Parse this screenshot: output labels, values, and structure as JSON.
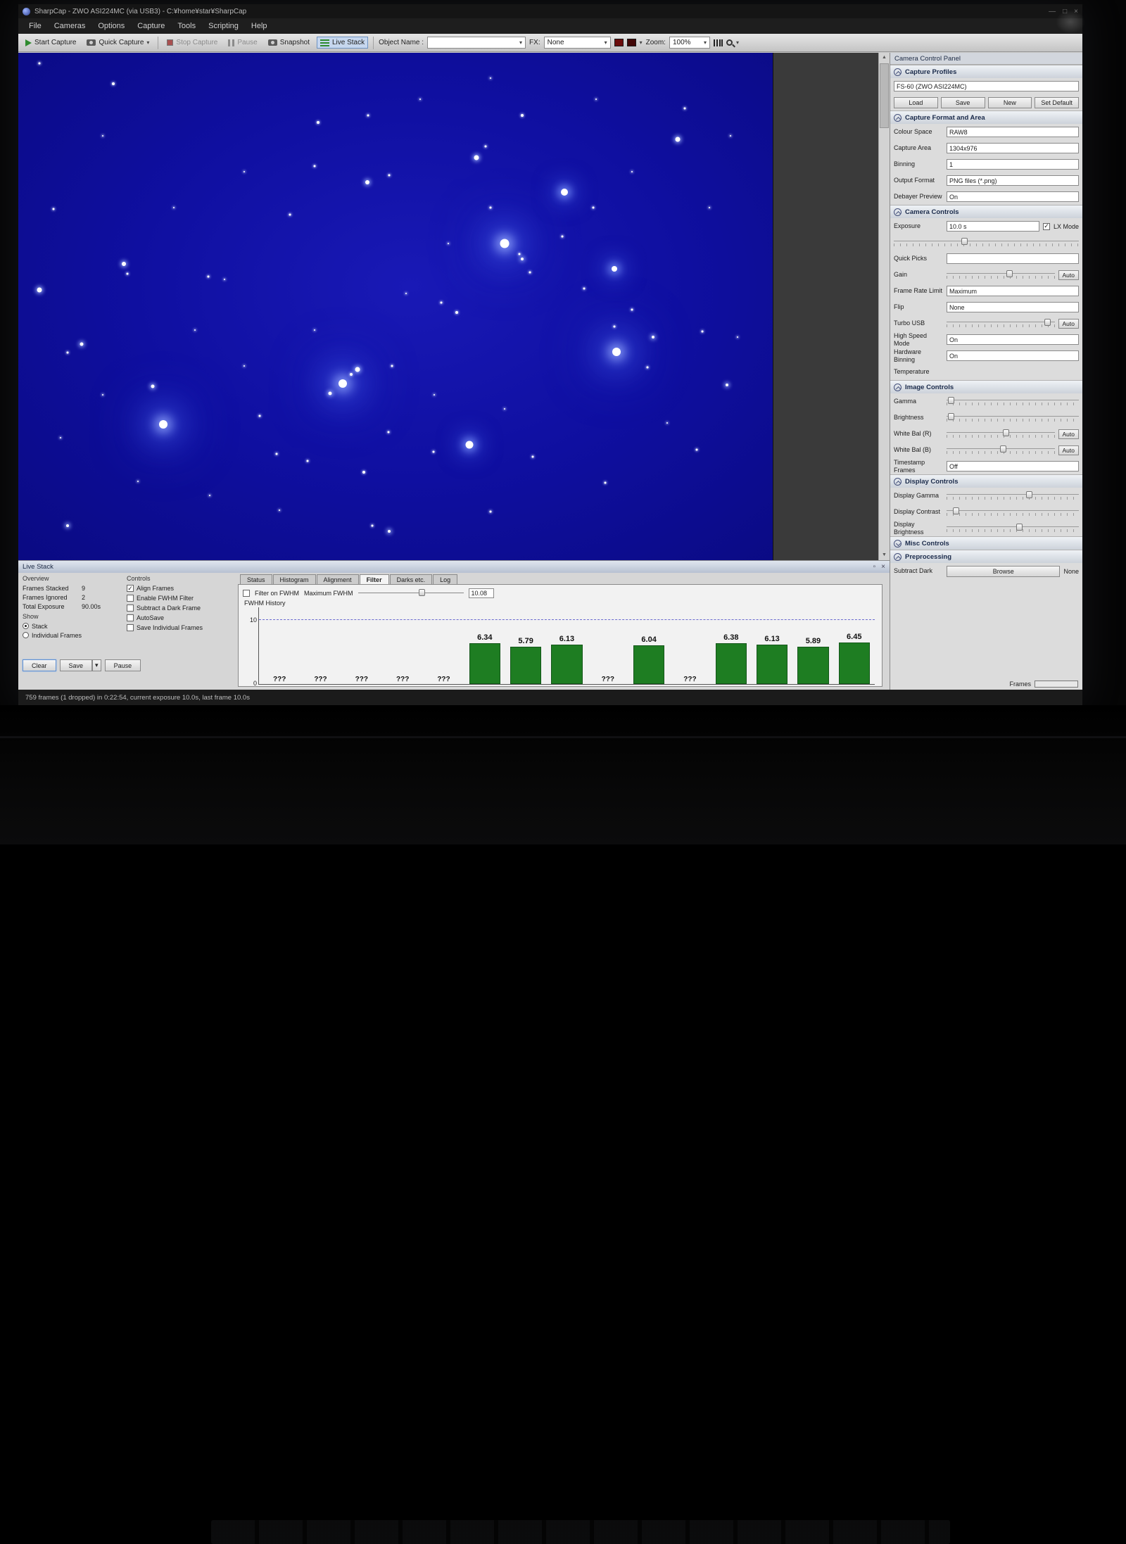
{
  "window": {
    "title": "SharpCap - ZWO ASI224MC (via USB3) - C:¥home¥star¥SharpCap"
  },
  "menu": {
    "items": [
      "File",
      "Cameras",
      "Options",
      "Capture",
      "Tools",
      "Scripting",
      "Help"
    ]
  },
  "toolbar": {
    "start_capture": "Start Capture",
    "quick_capture": "Quick Capture",
    "stop_capture": "Stop Capture",
    "pause": "Pause",
    "snapshot": "Snapshot",
    "live_stack": "Live Stack",
    "object_name_label": "Object Name :",
    "object_name_value": "",
    "fx_label": "FX:",
    "fx_value": "None",
    "zoom_label": "Zoom:",
    "zoom_value": "100%",
    "swatch1": "#6b0c0c",
    "swatch2": "#420808"
  },
  "camera_panel": {
    "title": "Camera Control Panel",
    "sections": [
      {
        "title": "Capture Profiles",
        "collapsed": false,
        "rows": [
          {
            "type": "wideinput",
            "value": "FS-60 (ZWO ASI224MC)"
          },
          {
            "type": "buttons",
            "buttons": [
              "Load",
              "Save",
              "New",
              "Set Default"
            ]
          }
        ]
      },
      {
        "title": "Capture Format and Area",
        "collapsed": false,
        "rows": [
          {
            "type": "combo",
            "label": "Colour Space",
            "value": "RAW8"
          },
          {
            "type": "combo",
            "label": "Capture Area",
            "value": "1304x976"
          },
          {
            "type": "combo",
            "label": "Binning",
            "value": "1"
          },
          {
            "type": "combo",
            "label": "Output Format",
            "value": "PNG files (*.png)"
          },
          {
            "type": "combo",
            "label": "Debayer Preview",
            "value": "On"
          }
        ]
      },
      {
        "title": "Camera Controls",
        "collapsed": false,
        "rows": [
          {
            "type": "exposure",
            "label": "Exposure",
            "value": "10.0 s",
            "checkbox": "LX Mode",
            "checked": true
          },
          {
            "type": "slider",
            "label": "",
            "pos": 38
          },
          {
            "type": "combo",
            "label": "Quick Picks",
            "value": ""
          },
          {
            "type": "slider-auto",
            "label": "Gain",
            "pos": 58,
            "auto": "Auto"
          },
          {
            "type": "combo",
            "label": "Frame Rate Limit",
            "value": "Maximum"
          },
          {
            "type": "combo",
            "label": "Flip",
            "value": "None"
          },
          {
            "type": "slider-auto",
            "label": "Turbo USB",
            "pos": 93,
            "auto": "Auto"
          },
          {
            "type": "combo",
            "label": "High Speed Mode",
            "value": "On"
          },
          {
            "type": "combo",
            "label": "Hardware Binning",
            "value": "On"
          },
          {
            "type": "value",
            "label": "Temperature",
            "value": ""
          }
        ]
      },
      {
        "title": "Image Controls",
        "collapsed": false,
        "rows": [
          {
            "type": "slider",
            "label": "Gamma",
            "pos": 3
          },
          {
            "type": "slider",
            "label": "Brightness",
            "pos": 3
          },
          {
            "type": "slider-auto",
            "label": "White Bal (R)",
            "pos": 55,
            "auto": "Auto"
          },
          {
            "type": "slider-auto",
            "label": "White Bal (B)",
            "pos": 52,
            "auto": "Auto"
          },
          {
            "type": "combo",
            "label": "Timestamp Frames",
            "value": "Off"
          }
        ]
      },
      {
        "title": "Display Controls",
        "collapsed": false,
        "rows": [
          {
            "type": "slider",
            "label": "Display Gamma",
            "pos": 62
          },
          {
            "type": "slider",
            "label": "Display Contrast",
            "pos": 7
          },
          {
            "type": "slider",
            "label": "Display Brightness",
            "pos": 55
          }
        ]
      },
      {
        "title": "Misc Controls",
        "collapsed": true,
        "rows": []
      },
      {
        "title": "Preprocessing",
        "collapsed": false,
        "rows": [
          {
            "type": "browse",
            "label": "Subtract Dark",
            "button": "Browse",
            "value": "None"
          }
        ]
      }
    ],
    "frames_label": "Frames",
    "frames_fill_color": "#2f9e2f"
  },
  "livestack": {
    "header": "Live Stack",
    "overview": {
      "title": "Overview",
      "rows": [
        {
          "label": "Frames Stacked",
          "value": "9"
        },
        {
          "label": "Frames Ignored",
          "value": "2"
        },
        {
          "label": "Total Exposure",
          "value": "90.00s"
        }
      ],
      "show_label": "Show",
      "radios": [
        {
          "label": "Stack",
          "selected": true
        },
        {
          "label": "Individual Frames",
          "selected": false
        }
      ],
      "buttons": [
        "Clear",
        "Save",
        "Pause"
      ]
    },
    "controls": {
      "title": "Controls",
      "items": [
        {
          "label": "Align Frames",
          "checked": true
        },
        {
          "label": "Enable FWHM Filter",
          "checked": false
        },
        {
          "label": "Subtract a Dark Frame",
          "checked": false
        },
        {
          "label": "AutoSave",
          "checked": false
        },
        {
          "label": "Save Individual Frames",
          "checked": false
        }
      ]
    },
    "tabs": [
      "Status",
      "Histogram",
      "Alignment",
      "Filter",
      "Darks etc.",
      "Log"
    ],
    "active_tab": "Filter",
    "filter": {
      "filter_on_fwhm_label": "Filter on FWHM",
      "filter_on_fwhm_checked": false,
      "maximum_fwhm_label": "Maximum FWHM",
      "maximum_fwhm_value": "10.08",
      "history_label": "FWHM History"
    }
  },
  "chart_data": {
    "type": "bar",
    "title": "FWHM History",
    "values": [
      null,
      null,
      null,
      null,
      null,
      6.34,
      5.79,
      6.13,
      null,
      6.04,
      null,
      6.38,
      6.13,
      5.89,
      6.45
    ],
    "null_label": "???",
    "ylim": [
      0,
      10
    ],
    "threshold": 10.08,
    "bar_color": "#1e7d22",
    "grid": false,
    "legend": "none"
  },
  "statusbar": {
    "text": "759 frames (1 dropped) in 0:22:54, current exposure 10.0s, last frame 10.0s"
  },
  "stars": [
    [
      64.5,
      37.6,
      13,
      3
    ],
    [
      72.4,
      27.4,
      10,
      2
    ],
    [
      79.3,
      58.9,
      12,
      3
    ],
    [
      43.0,
      65.2,
      12,
      3
    ],
    [
      19.2,
      73.3,
      12,
      3
    ],
    [
      59.8,
      77.3,
      11,
      2
    ],
    [
      79.0,
      42.6,
      8,
      2
    ],
    [
      45.0,
      62.4,
      7,
      1
    ],
    [
      87.4,
      17.0,
      7,
      1
    ],
    [
      60.7,
      20.6,
      7,
      1
    ],
    [
      46.3,
      25.5,
      6,
      1
    ],
    [
      2.8,
      46.8,
      7,
      1
    ],
    [
      14.0,
      41.6,
      6,
      1
    ],
    [
      8.4,
      57.4,
      5,
      1
    ],
    [
      17.8,
      65.7,
      5,
      1
    ],
    [
      12.6,
      6.1,
      4,
      0
    ],
    [
      2.8,
      2.1,
      3,
      0
    ],
    [
      39.7,
      13.8,
      4,
      0
    ],
    [
      46.4,
      12.3,
      3,
      0
    ],
    [
      66.8,
      12.3,
      4,
      0
    ],
    [
      88.3,
      10.9,
      3,
      0
    ],
    [
      61.9,
      18.4,
      3,
      0
    ],
    [
      39.3,
      22.3,
      3,
      0
    ],
    [
      49.2,
      24.1,
      3,
      0
    ],
    [
      36.0,
      31.9,
      3,
      0
    ],
    [
      4.7,
      30.8,
      3,
      0
    ],
    [
      25.2,
      44.1,
      3,
      0
    ],
    [
      27.3,
      44.7,
      2,
      0
    ],
    [
      56.1,
      49.2,
      3,
      0
    ],
    [
      58.1,
      51.2,
      4,
      0
    ],
    [
      66.8,
      40.7,
      4,
      1
    ],
    [
      75.0,
      46.4,
      3,
      0
    ],
    [
      84.1,
      56.0,
      4,
      1
    ],
    [
      90.7,
      54.9,
      3,
      0
    ],
    [
      93.9,
      65.4,
      4,
      1
    ],
    [
      83.4,
      62.0,
      3,
      0
    ],
    [
      49.1,
      74.8,
      3,
      0
    ],
    [
      38.3,
      80.4,
      3,
      0
    ],
    [
      45.8,
      82.6,
      4,
      0
    ],
    [
      49.2,
      94.3,
      4,
      1
    ],
    [
      46.9,
      93.2,
      3,
      0
    ],
    [
      55.0,
      78.7,
      3,
      0
    ],
    [
      62.6,
      90.4,
      3,
      0
    ],
    [
      6.5,
      93.2,
      4,
      1
    ],
    [
      14.5,
      43.5,
      3,
      0
    ],
    [
      6.5,
      59.1,
      3,
      0
    ],
    [
      32.0,
      71.6,
      3,
      0
    ],
    [
      34.2,
      79.0,
      3,
      0
    ],
    [
      79.0,
      53.9,
      3,
      0
    ],
    [
      81.3,
      50.6,
      3,
      0
    ],
    [
      89.9,
      78.2,
      3,
      0
    ],
    [
      77.8,
      84.7,
      3,
      0
    ],
    [
      68.2,
      79.6,
      3,
      0
    ],
    [
      41.3,
      67.1,
      5,
      1
    ],
    [
      44.1,
      63.4,
      4,
      0
    ],
    [
      49.5,
      61.7,
      3,
      0
    ],
    [
      66.4,
      39.7,
      3,
      0
    ],
    [
      67.8,
      43.3,
      3,
      0
    ],
    [
      72.1,
      36.2,
      3,
      0
    ],
    [
      76.2,
      30.5,
      3,
      0
    ],
    [
      62.6,
      30.5,
      3,
      0
    ],
    [
      57.0,
      37.6,
      2,
      0
    ],
    [
      51.4,
      47.5,
      2,
      0
    ],
    [
      39.3,
      54.6,
      2,
      0
    ],
    [
      29.9,
      61.7,
      2,
      0
    ],
    [
      23.4,
      54.6,
      2,
      0
    ],
    [
      11.2,
      67.4,
      2,
      0
    ],
    [
      5.6,
      75.9,
      2,
      0
    ],
    [
      15.9,
      84.4,
      2,
      0
    ],
    [
      25.4,
      87.2,
      2,
      0
    ],
    [
      34.6,
      90.1,
      2,
      0
    ],
    [
      55.1,
      67.4,
      2,
      0
    ],
    [
      64.5,
      70.2,
      2,
      0
    ],
    [
      86.0,
      73.0,
      2,
      0
    ],
    [
      95.3,
      56.0,
      2,
      0
    ],
    [
      91.6,
      30.5,
      2,
      0
    ],
    [
      81.3,
      23.4,
      2,
      0
    ],
    [
      53.3,
      9.2,
      2,
      0
    ],
    [
      29.9,
      23.4,
      2,
      0
    ],
    [
      20.6,
      30.5,
      2,
      0
    ],
    [
      11.2,
      16.3,
      2,
      0
    ],
    [
      62.6,
      5.0,
      2,
      0
    ],
    [
      76.6,
      9.2,
      2,
      0
    ],
    [
      94.4,
      16.3,
      2,
      0
    ]
  ]
}
